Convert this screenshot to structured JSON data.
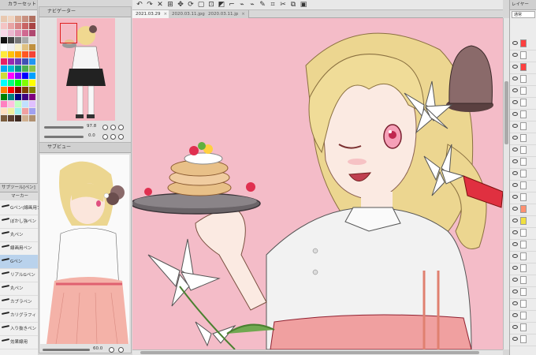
{
  "palette_panel": {
    "title": "カラーセット",
    "swatches": [
      "#e8c8b0",
      "#f0d4c0",
      "#d8a890",
      "#c89080",
      "#b07060",
      "#f4c4c4",
      "#e8a4a4",
      "#d88484",
      "#c86464",
      "#a84444",
      "#f8d8e8",
      "#ecb8d0",
      "#e090b0",
      "#d06890",
      "#b04870",
      "#111111",
      "#444444",
      "#777777",
      "#aaaaaa",
      "#dddddd",
      "#ffffff",
      "#f0f0f0",
      "#f8f0c8",
      "#e0c080",
      "#c09040",
      "#ffeb3b",
      "#ffc107",
      "#ff9800",
      "#ff5722",
      "#f44336",
      "#e91e63",
      "#9c27b0",
      "#673ab7",
      "#3f51b5",
      "#2196f3",
      "#03a9f4",
      "#00bcd4",
      "#009688",
      "#4caf50",
      "#8bc34a",
      "#cddc39",
      "#ff00ff",
      "#8000ff",
      "#0000ff",
      "#00a0ff",
      "#00ffff",
      "#00ff80",
      "#00ff00",
      "#80ff00",
      "#ffff00",
      "#ff8000",
      "#ff0000",
      "#800000",
      "#804000",
      "#808000",
      "#008000",
      "#008080",
      "#000080",
      "#400080",
      "#800080",
      "#ff80c0",
      "#ffc0e0",
      "#c0ffc0",
      "#c0e0ff",
      "#e0c0ff",
      "#ffe0c0",
      "#f0f0a0",
      "#a0f0f0",
      "#f0a0a0",
      "#a0a0f0",
      "#7a5c3c",
      "#5c4030",
      "#3c2820",
      "#d0b090",
      "#b09070"
    ]
  },
  "tool_tab": {
    "label": "サブツール[ペン]"
  },
  "brush_list": {
    "header": "マーカー",
    "items": [
      {
        "label": "Gペン(線画用ブラシ"
      },
      {
        "label": "ぼかし強ペン"
      },
      {
        "label": "丸ペン"
      },
      {
        "label": "線画用ペン"
      },
      {
        "label": "Gペン",
        "selected": true
      },
      {
        "label": "リアルGペン"
      },
      {
        "label": "丸ペン"
      },
      {
        "label": "カブラペン"
      },
      {
        "label": "カリグラフィ"
      },
      {
        "label": "入り抜きペン"
      },
      {
        "label": "効果線用"
      }
    ]
  },
  "navigator": {
    "title": "ナビゲーター",
    "zoom": "97.8",
    "angle": "0.0"
  },
  "subview": {
    "title": "サブビュー",
    "zoom": "60.0"
  },
  "toolbar": {
    "icons": [
      "undo-icon",
      "redo-icon",
      "clear-icon",
      "transform-icon",
      "move-icon",
      "rotate-icon",
      "select-all-icon",
      "deselect-icon",
      "invert-icon",
      "ruler-icon",
      "snap-icon",
      "snap-icon",
      "pen-icon",
      "crop-icon",
      "cut-icon",
      "copy-icon",
      "fill-icon"
    ]
  },
  "tabs": [
    {
      "label": "2021.03.29",
      "active": true
    },
    {
      "label": "2020.03.11.jpg",
      "active": false
    },
    {
      "label": "2020.03.11.jp",
      "active": false
    }
  ],
  "layer_panel": {
    "title": "レイヤー",
    "blend_mode": "通常",
    "layer_colors": [
      "#ff4040",
      "#ffffff",
      "#ff4040",
      "#ffffff",
      "#ffffff",
      "#ffffff",
      "#ffffff",
      "#ffffff",
      "#ffffff",
      "#ffffff",
      "#ffffff",
      "#ffffff",
      "#ffffff",
      "#ffffff",
      "#ff9070",
      "#f0e040",
      "#ffffff",
      "#ffffff",
      "#ffffff",
      "#ffffff",
      "#ffffff",
      "#ffffff",
      "#ffffff",
      "#ffffff",
      "#ffffff",
      "#ffffff"
    ]
  }
}
